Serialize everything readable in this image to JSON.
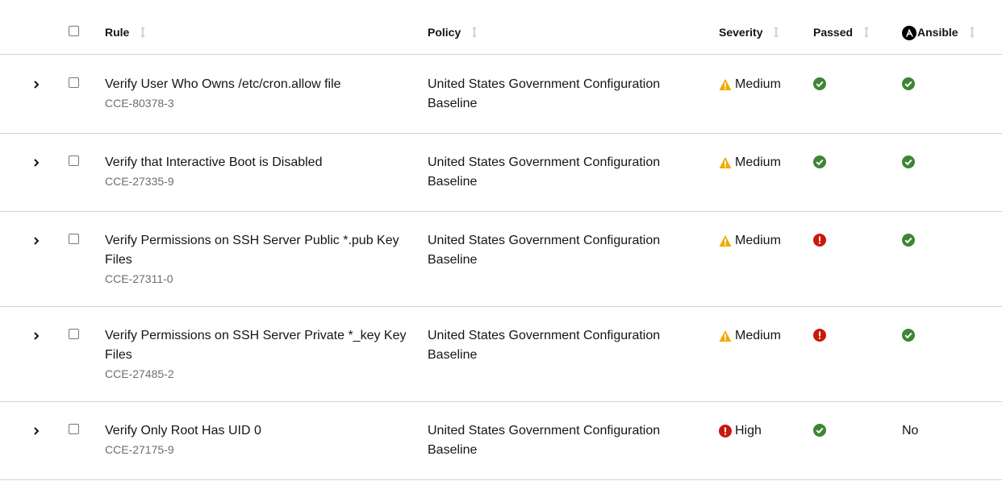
{
  "columns": {
    "rule": "Rule",
    "policy": "Policy",
    "severity": "Severity",
    "passed": "Passed",
    "ansible": "Ansible"
  },
  "colors": {
    "passed": "#3e8635",
    "failed": "#c9190b",
    "warning": "#f0ab00",
    "border": "#d2d2d2",
    "muted": "#6a6e73"
  },
  "rows": [
    {
      "title": "Verify User Who Owns /etc/cron.allow file",
      "id": "CCE-80378-3",
      "policy": "United States Government Configuration Baseline",
      "severity": "Medium",
      "severity_icon": "warning-triangle-icon",
      "passed": "check-circle-icon",
      "ansible": "check-circle-icon"
    },
    {
      "title": "Verify that Interactive Boot is Disabled",
      "id": "CCE-27335-9",
      "policy": "United States Government Configuration Baseline",
      "severity": "Medium",
      "severity_icon": "warning-triangle-icon",
      "passed": "check-circle-icon",
      "ansible": "check-circle-icon"
    },
    {
      "title": "Verify Permissions on SSH Server Public *.pub Key Files",
      "id": "CCE-27311-0",
      "policy": "United States Government Configuration Baseline",
      "severity": "Medium",
      "severity_icon": "warning-triangle-icon",
      "passed": "exclamation-circle-icon",
      "ansible": "check-circle-icon"
    },
    {
      "title": "Verify Permissions on SSH Server Private *_key Key Files",
      "id": "CCE-27485-2",
      "policy": "United States Government Configuration Baseline",
      "severity": "Medium",
      "severity_icon": "warning-triangle-icon",
      "passed": "exclamation-circle-icon",
      "ansible": "check-circle-icon"
    },
    {
      "title": "Verify Only Root Has UID 0",
      "id": "CCE-27175-9",
      "policy": "United States Government Configuration Baseline",
      "severity": "High",
      "severity_icon": "exclamation-circle-icon",
      "passed": "check-circle-icon",
      "ansible": "No"
    }
  ]
}
